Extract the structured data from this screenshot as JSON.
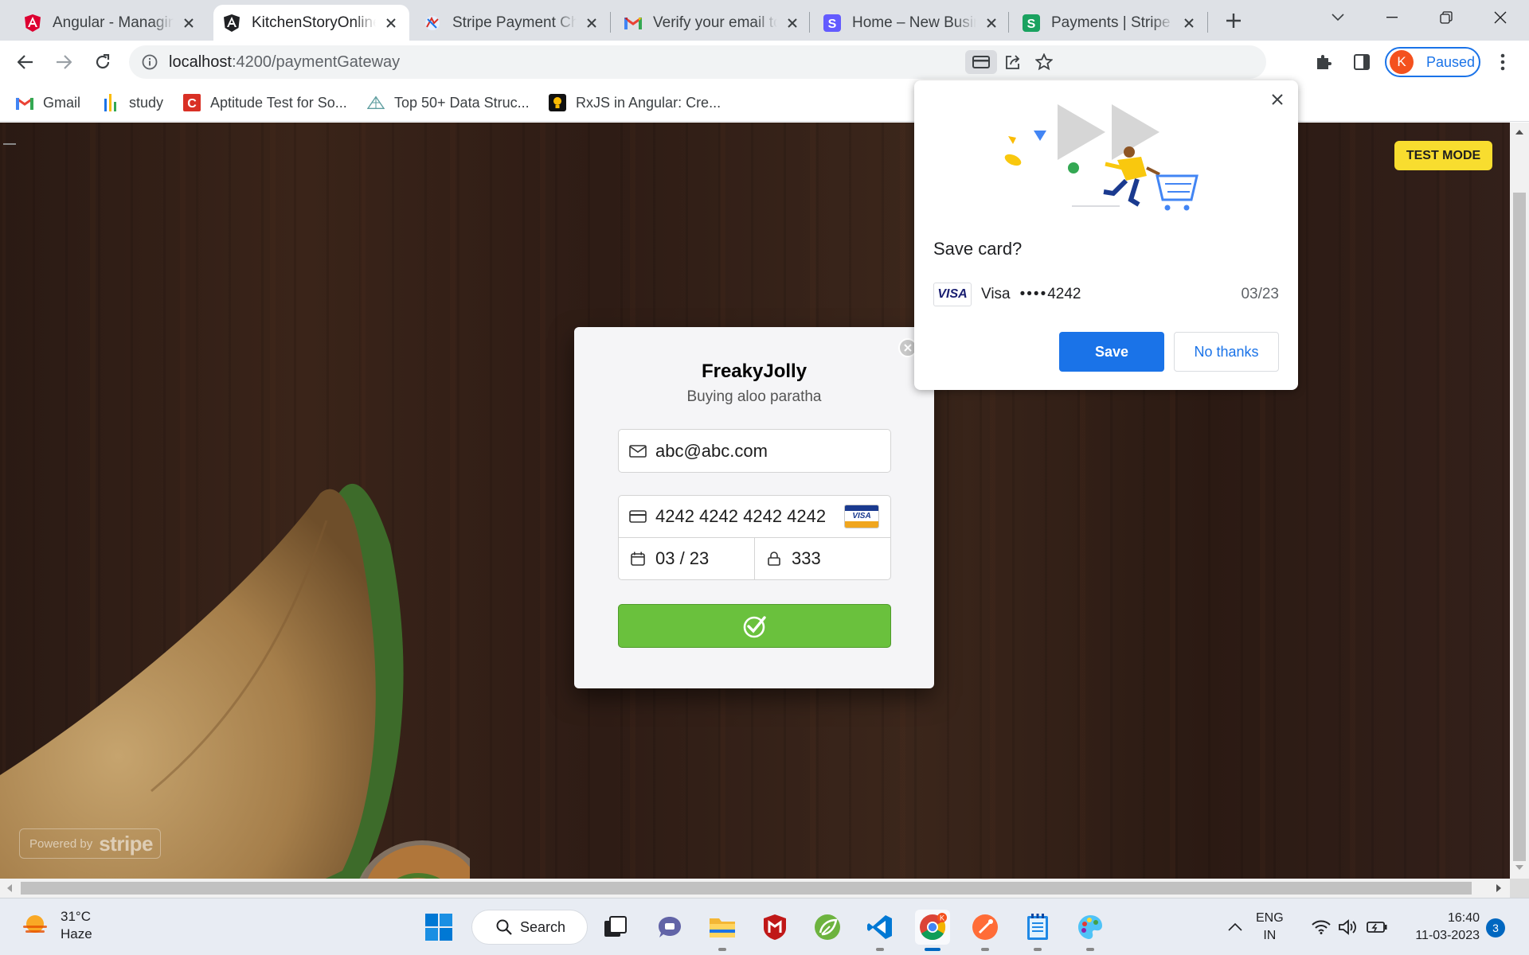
{
  "browser": {
    "tabs": [
      {
        "title": "Angular - Managing",
        "icon": "angular-icon",
        "active": false
      },
      {
        "title": "KitchenStoryOnline",
        "icon": "angular-dark-icon",
        "active": true
      },
      {
        "title": "Stripe Payment Che",
        "icon": "freakyjolly-icon",
        "active": false
      },
      {
        "title": "Verify your email to",
        "icon": "gmail-icon",
        "active": false
      },
      {
        "title": "Home – New Busin",
        "icon": "stripe-icon",
        "active": false
      },
      {
        "title": "Payments | Stripe D",
        "icon": "stripe-green-icon",
        "active": false
      }
    ],
    "url_host": "localhost",
    "url_path": ":4200/paymentGateway",
    "profile_initial": "K",
    "profile_label": "Paused",
    "bookmarks": [
      {
        "label": "Gmail",
        "icon": "gmail-icon"
      },
      {
        "label": "study",
        "icon": "folder-chart-icon"
      },
      {
        "label": "Aptitude Test for So...",
        "icon": "c-logo-icon"
      },
      {
        "label": "Top 50+ Data Struc...",
        "icon": "pyramid-icon"
      },
      {
        "label": "RxJS in Angular: Cre...",
        "icon": "bulb-icon"
      }
    ]
  },
  "page": {
    "test_mode_label": "TEST MODE",
    "powered_by_label": "Powered by",
    "powered_by_brand": "stripe"
  },
  "checkout": {
    "merchant_name": "FreakyJolly",
    "description": "Buying aloo paratha",
    "email_value": "abc@abc.com",
    "card_number_value": "4242 4242 4242 4242",
    "card_brand_label": "VISA",
    "expiry_value": "03 / 23",
    "cvc_value": "333"
  },
  "save_card_bubble": {
    "title": "Save card?",
    "card_brand_badge": "VISA",
    "card_brand": "Visa",
    "card_dots": "••••",
    "card_last4": "4242",
    "card_expiry": "03/23",
    "save_label": "Save",
    "no_thanks_label": "No thanks"
  },
  "taskbar": {
    "temperature": "31°C",
    "weather_condition": "Haze",
    "search_label": "Search",
    "language_line1": "ENG",
    "language_line2": "IN",
    "time": "16:40",
    "date": "11-03-2023",
    "notification_count": "3"
  },
  "colors": {
    "stripe_pay_green": "#6ac13d",
    "chrome_blue": "#1a73e8",
    "test_mode_yellow": "#f8dd2f",
    "profile_avatar": "#f4511e"
  }
}
